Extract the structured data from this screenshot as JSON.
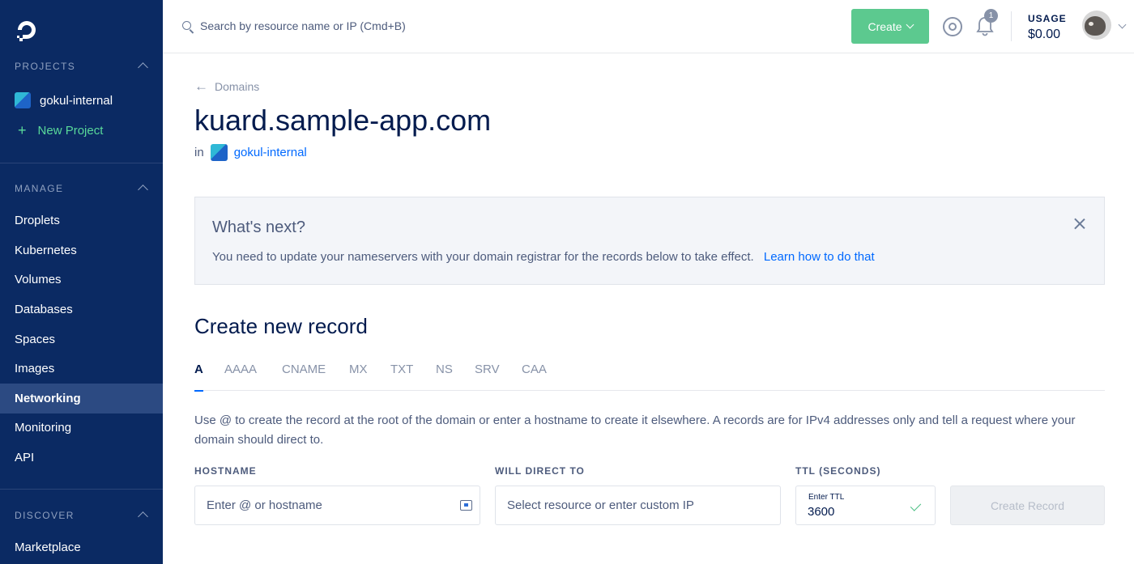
{
  "sidebar": {
    "projects_heading": "PROJECTS",
    "project_name": "gokul-internal",
    "new_project": "New Project",
    "manage_heading": "MANAGE",
    "manage_items": [
      "Droplets",
      "Kubernetes",
      "Volumes",
      "Databases",
      "Spaces",
      "Images",
      "Networking",
      "Monitoring",
      "API"
    ],
    "active_item": "Networking",
    "discover_heading": "DISCOVER",
    "discover_items": [
      "Marketplace"
    ]
  },
  "topbar": {
    "search_placeholder": "Search by resource name or IP (Cmd+B)",
    "create_label": "Create",
    "notification_count": "1",
    "usage_label": "USAGE",
    "usage_value": "$0.00"
  },
  "main": {
    "breadcrumb": "Domains",
    "title": "kuard.sample-app.com",
    "in_label": "in",
    "project_link": "gokul-internal",
    "notice": {
      "title": "What's next?",
      "text": "You need to update your nameservers with your domain registrar for the records below to take effect.",
      "link": "Learn how to do that"
    },
    "section_title": "Create new record",
    "tabs": [
      "A",
      "AAAA",
      "CNAME",
      "MX",
      "TXT",
      "NS",
      "SRV",
      "CAA"
    ],
    "active_tab": "A",
    "description": "Use @ to create the record at the root of the domain or enter a hostname to create it elsewhere. A records are for IPv4 addresses only and tell a request where your domain should direct to.",
    "form": {
      "hostname_label": "HOSTNAME",
      "hostname_placeholder": "Enter @ or hostname",
      "direct_label": "WILL DIRECT TO",
      "direct_placeholder": "Select resource or enter custom IP",
      "ttl_label": "TTL (SECONDS)",
      "ttl_inner_label": "Enter TTL",
      "ttl_value": "3600",
      "submit_label": "Create Record"
    }
  },
  "colors": {
    "sidebar_bg": "#0b2a63",
    "accent_green": "#5cc98f",
    "link_blue": "#0069ff",
    "text_dark": "#031b4e"
  }
}
